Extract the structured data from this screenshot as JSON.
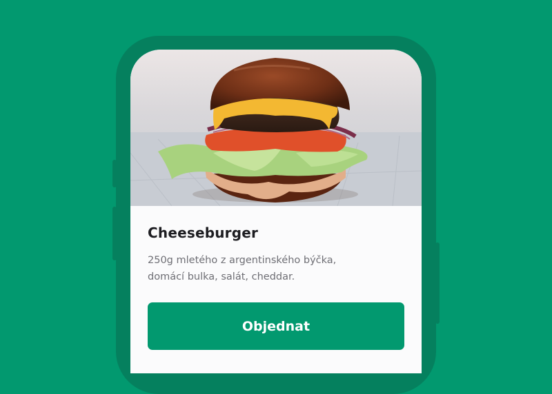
{
  "product": {
    "image_name": "cheeseburger-photo",
    "title": "Cheeseburger",
    "description": "250g mletého z argentinského býčka, domácí bulka, salát, cheddar.",
    "order_label": "Objednat"
  },
  "colors": {
    "background": "#02996f",
    "phone_frame": "#05805e",
    "button": "#02996f",
    "button_text": "#ffffff",
    "card": "#fbfbfc",
    "title_text": "#1d1d21",
    "description_text": "#6e6e74"
  }
}
